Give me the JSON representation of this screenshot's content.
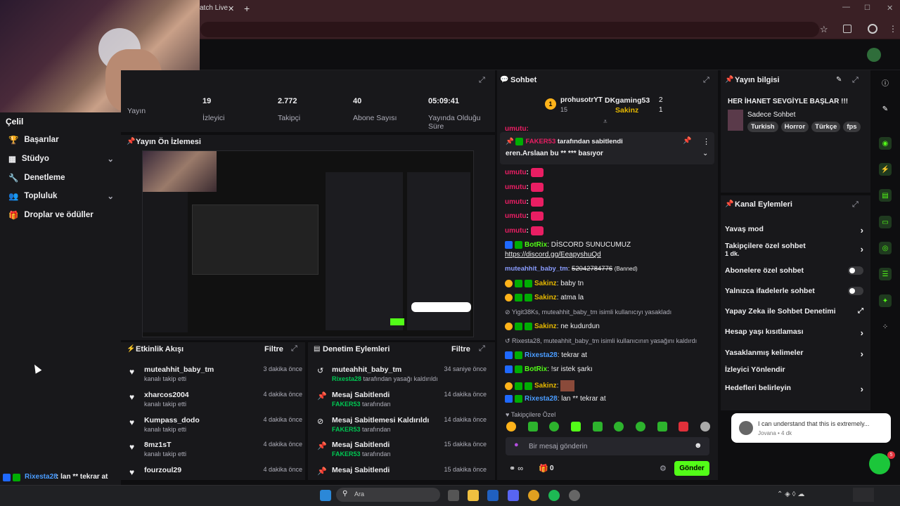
{
  "browser": {
    "tab_title": "atch Live",
    "new_tab": "+"
  },
  "sidebar": {
    "items": [
      {
        "label": "Başarılar",
        "has_chevron": false
      },
      {
        "label": "Stüdyo",
        "has_chevron": true
      },
      {
        "label": "Denetleme",
        "has_chevron": false
      },
      {
        "label": "Topluluk",
        "has_chevron": true
      },
      {
        "label": "Droplar ve ödüller",
        "has_chevron": false
      }
    ],
    "overlay_label": "Çelil"
  },
  "stats": [
    {
      "value": "",
      "label": "Yayın"
    },
    {
      "value": "19",
      "label": "İzleyici"
    },
    {
      "value": "2.772",
      "label": "Takipçi"
    },
    {
      "value": "40",
      "label": "Abone Sayısı"
    },
    {
      "value": "05:09:41",
      "label": "Yayında Olduğu Süre"
    }
  ],
  "preview": {
    "title": "Yayın Ön İzlemesi"
  },
  "activity": {
    "title": "Etkinlik Akışı",
    "filter": "Filtre",
    "rows": [
      {
        "name": "muteahhit_baby_tm",
        "sub": "kanalı takip etti",
        "time": "3 dakika önce"
      },
      {
        "name": "xharcos2004",
        "sub": "kanalı takip etti",
        "time": "4 dakika önce"
      },
      {
        "name": "Kumpass_dodo",
        "sub": "kanalı takip etti",
        "time": "4 dakika önce"
      },
      {
        "name": "8mz1sT",
        "sub": "kanalı takip etti",
        "time": "4 dakika önce"
      },
      {
        "name": "fourzoul29",
        "sub": "",
        "time": "4 dakika önce"
      }
    ]
  },
  "modlog": {
    "title": "Denetim Eylemleri",
    "filter": "Filtre",
    "rows": [
      {
        "name": "muteahhit_baby_tm",
        "actor": "Rixesta28",
        "sub": " tarafından yasağı kaldırıldı",
        "time": "34 saniye önce"
      },
      {
        "name": "Mesaj Sabitlendi",
        "actor": "FAKER53",
        "sub": " tarafından",
        "time": "14 dakika önce"
      },
      {
        "name": "Mesaj Sabitlemesi Kaldırıldı",
        "actor": "FAKER53",
        "sub": " tarafından",
        "time": "14 dakika önce"
      },
      {
        "name": "Mesaj Sabitlendi",
        "actor": "FAKER53",
        "sub": " tarafından",
        "time": "15 dakika önce"
      },
      {
        "name": "Mesaj Sabitlendi",
        "actor": "",
        "sub": "",
        "time": "15 dakika önce"
      }
    ]
  },
  "chat": {
    "title": "Sohbet",
    "top_users": [
      {
        "name": "prohusotrYT",
        "count": "15"
      },
      {
        "name": "DKgaming53",
        "count": "2"
      },
      {
        "name": "Sakinz",
        "count": "1"
      }
    ],
    "pinned": {
      "by": "FAKER53",
      "by_suffix": " tarafından sabitlendi",
      "text": "eren.Arslaan bu ** *** basıyor"
    },
    "partial_top": "umutu:",
    "lines": [
      {
        "user": "umutu",
        "color": "#e91e63",
        "text": "",
        "emote": true
      },
      {
        "user": "umutu",
        "color": "#e91e63",
        "text": "",
        "emote": true
      },
      {
        "user": "umutu",
        "color": "#e91e63",
        "text": "",
        "emote": true
      },
      {
        "user": "umutu",
        "color": "#e91e63",
        "text": "",
        "emote": true
      },
      {
        "user": "umutu",
        "color": "#e91e63",
        "text": "",
        "emote": true
      }
    ],
    "botrix1_user": "BotRix",
    "botrix1_text": "DİSCORD SUNUCUMUZ",
    "botrix1_link": "https://discord.gg/EeapyshuQd",
    "ban_user": "muteahhit_baby_tm",
    "ban_text": "52042784776",
    "ban_tag": "(Banned)",
    "msg1_user": "Sakinz",
    "msg1_text": "baby tn",
    "msg2_user": "Sakinz",
    "msg2_text": "atma la",
    "sys1": "Yigit38Ks, muteahhit_baby_tm isimli kullanıcıyı yasakladı",
    "msg3_user": "Sakinz",
    "msg3_text": "ne kudurdun",
    "sys2": "Rixesta28, muteahhit_baby_tm isimli kullanıcının yasağını kaldırdı",
    "msg4_user": "Rixesta28",
    "msg4_text": "tekrar at",
    "msg5_user": "BotRix",
    "msg5_text": "!sr istek şarkı",
    "msg6_user": "Sakinz",
    "msg6_text": "",
    "msg7_user": "Rixesta28",
    "msg7_text": "lan ** tekrar at",
    "followers_only": "Takipçilere Özel",
    "input_placeholder": "Bir mesaj gönderin",
    "points": "0",
    "send": "Gönder"
  },
  "stream_info": {
    "title": "Yayın bilgisi",
    "stream_title": "HER İHANET SEVGİYLE BAŞLAR !!!",
    "category": "Sadece Sohbet",
    "tags": [
      "Turkish",
      "Horror",
      "Türkçe",
      "fps"
    ]
  },
  "channel_actions": {
    "title": "Kanal Eylemleri",
    "rows": [
      {
        "label": "Yavaş mod",
        "control": "arrow"
      },
      {
        "label": "Takipçilere özel sohbet",
        "sub": "1 dk.",
        "control": "arrow"
      },
      {
        "label": "Abonelere özel sohbet",
        "control": "toggle"
      },
      {
        "label": "Yalnızca ifadelerle sohbet",
        "control": "toggle"
      },
      {
        "label": "Yapay Zeka ile Sohbet Denetimi",
        "control": "link"
      },
      {
        "label": "Hesap yaşı kısıtlaması",
        "control": "arrow"
      },
      {
        "label": "Yasaklanmış kelimeler",
        "control": "arrow"
      },
      {
        "label": "İzleyici Yönlendir",
        "control": "none"
      },
      {
        "label": "Hedefleri belirleyin",
        "control": "arrow"
      }
    ]
  },
  "notification": {
    "text": "I can understand that this is extremely...",
    "author": "Jovana",
    "time": "4 dk"
  },
  "overlay_chat": {
    "user": "Rixesta28",
    "text": ": lan ** tekrar at"
  },
  "taskbar": {
    "search": "Ara",
    "badge": "5"
  },
  "colors": {
    "accent": "#53fc18",
    "mod": "#00ad03",
    "bg": "#0e0e10",
    "panel": "#18181b"
  }
}
